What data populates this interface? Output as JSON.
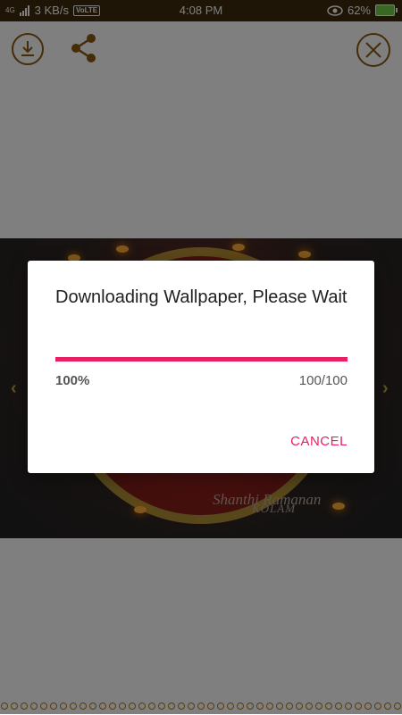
{
  "status_bar": {
    "network_speed": "3 KB/s",
    "volte": "VoLTE",
    "time": "4:08 PM",
    "battery_percent": "62%",
    "signal_label": "4G"
  },
  "toolbar": {
    "download_icon": "download-icon",
    "share_icon": "share-icon",
    "close_icon": "close-icon",
    "accent_color": "#3d2a0c"
  },
  "wallpaper": {
    "caption_line1": "Shanthi Ramanan",
    "caption_line2": "KOLAM"
  },
  "dialog": {
    "title": "Downloading Wallpaper, Please Wait",
    "progress": 1.0,
    "progress_percent_text": "100%",
    "progress_count_text": "100/100",
    "cancel_label": "CANCEL",
    "progress_color": "#e91e63",
    "progress_track_color": "#f7c4d7"
  }
}
